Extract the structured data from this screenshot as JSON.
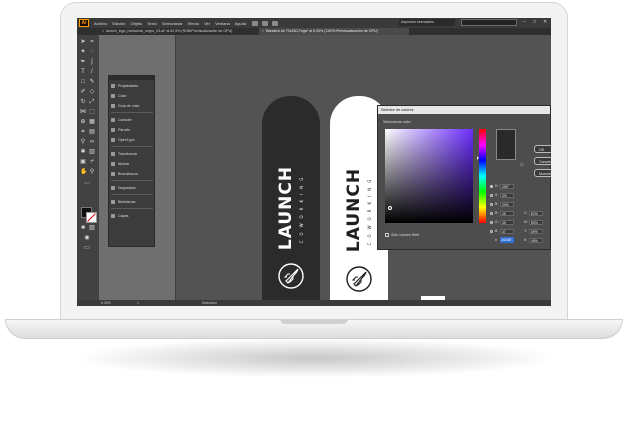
{
  "menubar": {
    "logo": "Ai",
    "items": [
      "Archivo",
      "Edición",
      "Objeto",
      "Texto",
      "Seleccionar",
      "Efecto",
      "Ver",
      "Ventana",
      "Ayuda"
    ],
    "workspace": "Aspectos esenciales",
    "window_controls": [
      "–",
      "□",
      "✕"
    ]
  },
  "tabs": [
    {
      "label": "launch_logo_horizontal_negro_03.ai* al 62,5% (RGB/Previsualización de GPU)",
      "active": false
    },
    {
      "label": "Bandera de 70x150-Fuga* al 6,25% (CMYK/Previsualización de GPU)",
      "active": true
    }
  ],
  "panels": {
    "items": [
      "Propiedades",
      "Color",
      "Guía de color",
      "Carácter",
      "Párrafo",
      "OpenType",
      "Transformar",
      "Alinear",
      "Buscatrazos",
      "Degradado",
      "Bibliotecas",
      "Capas"
    ]
  },
  "flags": {
    "brand": "LAUNCH",
    "tagline": "COWORKING"
  },
  "color_picker": {
    "title": "Selector de colores",
    "subtitle": "Seleccionar color:",
    "buttons": [
      "OK",
      "Cancelar",
      "Muestras de color"
    ],
    "fields": [
      {
        "label": "H:",
        "value": "259°",
        "selected": true
      },
      {
        "label": "S:",
        "value": "0%",
        "selected": false
      },
      {
        "label": "B:",
        "value": "20%",
        "selected": false
      },
      {
        "label": "R:",
        "value": "45",
        "selected": false
      },
      {
        "label": "G:",
        "value": "45",
        "selected": false
      },
      {
        "label": "B:",
        "value": "47",
        "selected": false
      }
    ],
    "cmyk": [
      {
        "label": "C:",
        "value": "82%"
      },
      {
        "label": "M:",
        "value": "80%"
      },
      {
        "label": "Y:",
        "value": "69%"
      },
      {
        "label": "K:",
        "value": "49%"
      }
    ],
    "hex_label": "#",
    "hex": "2d2d2f",
    "web_only_label": "Sólo colores Web"
  },
  "status": {
    "zoom": "6,25%",
    "page": "1",
    "tool": "Selección"
  },
  "colors": {
    "accent": "#ff9a00",
    "ui_dark": "#535353",
    "flag_dark": "#2b2b2b"
  }
}
